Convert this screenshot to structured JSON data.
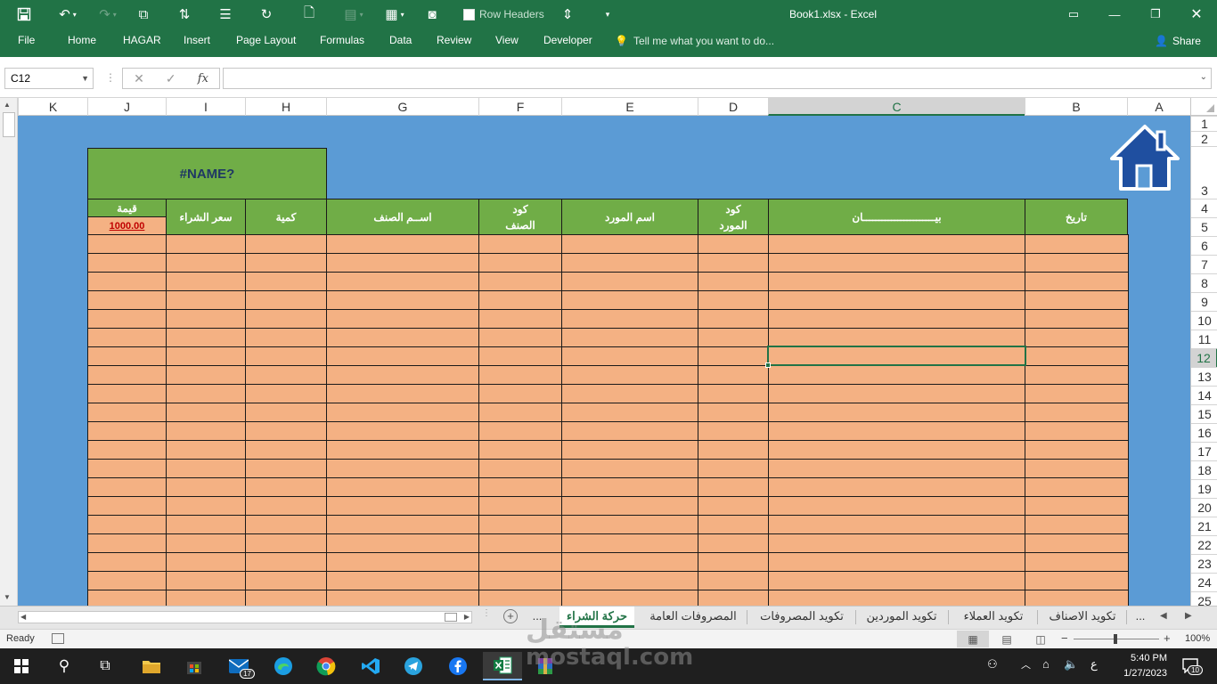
{
  "app": {
    "title": "Book1.xlsx - Excel",
    "row_headers_label": "Row Headers"
  },
  "ribbon": {
    "tabs": [
      "File",
      "Home",
      "HAGAR",
      "Insert",
      "Page Layout",
      "Formulas",
      "Data",
      "Review",
      "View",
      "Developer"
    ],
    "tell_me": "Tell me what you want to do...",
    "share": "Share"
  },
  "formula_bar": {
    "name_box": "C12",
    "fx": "fx",
    "formula": ""
  },
  "columns": [
    "K",
    "J",
    "I",
    "H",
    "G",
    "F",
    "E",
    "D",
    "C",
    "B",
    "A"
  ],
  "selected_column": "C",
  "rows": [
    "1",
    "2",
    "3",
    "4",
    "5",
    "6",
    "7",
    "8",
    "9",
    "10",
    "11",
    "12",
    "13",
    "14",
    "15",
    "16",
    "17",
    "18",
    "19",
    "20",
    "21",
    "22",
    "23",
    "24",
    "25"
  ],
  "selected_row": "12",
  "sheet": {
    "name_cell": "#NAME?",
    "headers": {
      "date": "تاريخ",
      "statement": "بيـــــــــــــــــــــــان",
      "supplier_code": "كود المورد",
      "supplier_name": "اسم المورد",
      "item_code": "كود الصنف",
      "item_name": "اســم الصنف",
      "quantity": "كمية",
      "purchase_price": "سعر الشراء",
      "value": "قيمة"
    },
    "value_total": "1000.00"
  },
  "sheet_tabs": {
    "tabs": [
      "حركة الشراء",
      "المصروفات العامة",
      "تكويد المصروفات",
      "تكويد الموردين",
      "تكويد العملاء",
      "تكويد الاصناف"
    ],
    "active": "حركة الشراء",
    "more": "..."
  },
  "status": {
    "ready": "Ready",
    "zoom": "100%"
  },
  "taskbar": {
    "time": "5:40 PM",
    "date": "1/27/2023",
    "mail_badge": "17",
    "notif_badge": "10",
    "lang": "ع"
  },
  "watermark": {
    "line1": "مستقل",
    "line2": "mostaql.com"
  },
  "colors": {
    "excel_green": "#217346",
    "sheet_bg": "#5b9bd5",
    "header_green": "#70ad47",
    "body_salmon": "#f4b183",
    "value_red": "#c00000"
  }
}
